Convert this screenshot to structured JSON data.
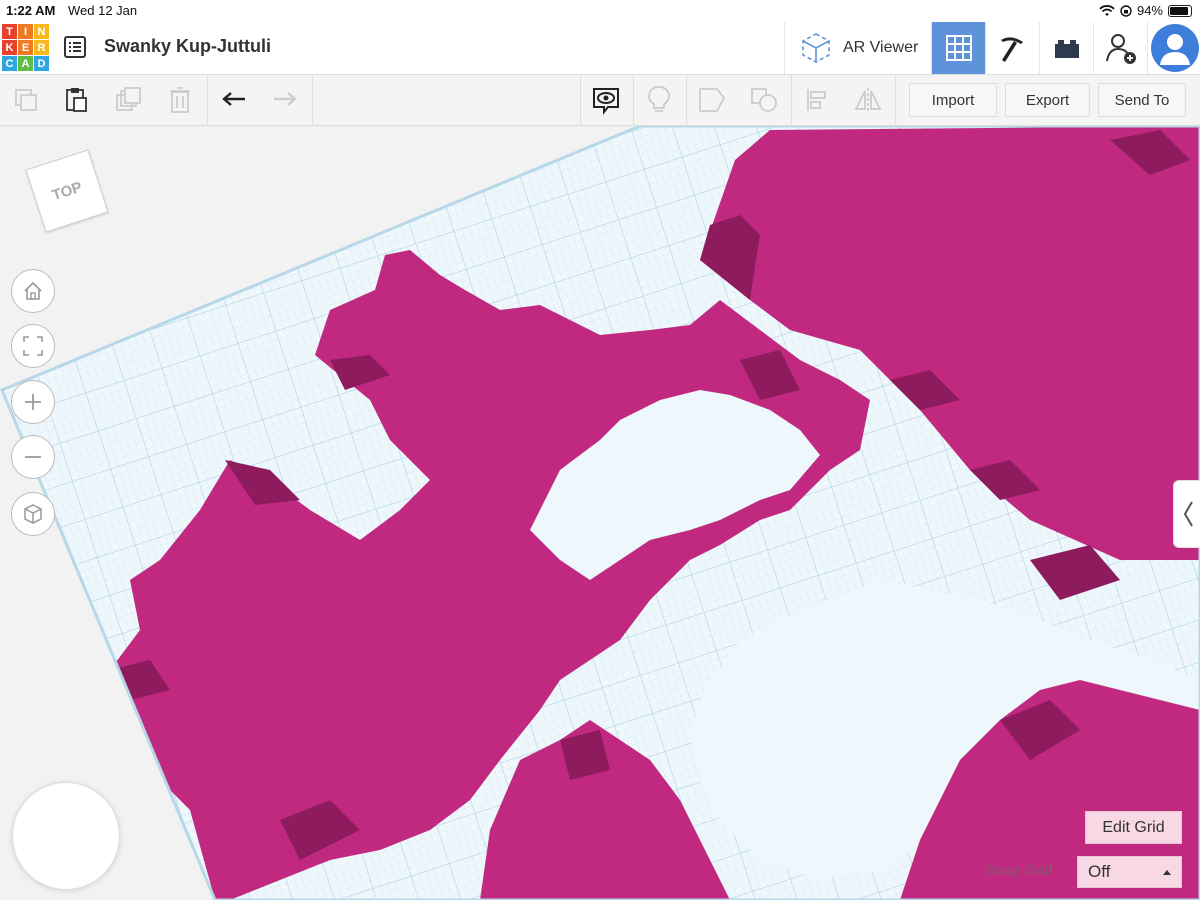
{
  "status": {
    "time": "1:22 AM",
    "date": "Wed 12 Jan",
    "battery": "94%"
  },
  "logo": {
    "letters": [
      "T",
      "I",
      "N",
      "K",
      "E",
      "R",
      "C",
      "A",
      "D"
    ],
    "colors": [
      "#e8412c",
      "#f07a22",
      "#f6b81b",
      "#e8412c",
      "#f07a22",
      "#f6b81b",
      "#2fa6e0",
      "#5fbc48",
      "#2fa6e0"
    ]
  },
  "header": {
    "title": "Swanky Kup-Juttuli",
    "ar_label": "AR Viewer"
  },
  "toolbar": {
    "import_label": "Import",
    "export_label": "Export",
    "send_label": "Send To"
  },
  "viewcube": {
    "label": "TOP"
  },
  "grid": {
    "edit_label": "Edit Grid",
    "snap_label": "Snap Grid",
    "snap_value": "Off"
  },
  "colors": {
    "shape": "#c0297f",
    "shape_dark": "#8d1b5e",
    "grid_bg": "#eef7fb",
    "grid_line": "#bfdbea",
    "accent": "#5f93d9"
  }
}
